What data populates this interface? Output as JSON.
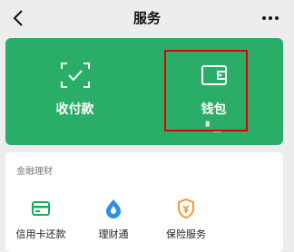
{
  "header": {
    "title": "服务",
    "back_icon": "chevron-left-icon",
    "more_icon": "more-dots-icon"
  },
  "wallet_card": {
    "color": "#2aae67",
    "tiles": [
      {
        "label": "收付款",
        "icon": "scan-pay-icon"
      },
      {
        "label": "钱包",
        "icon": "wallet-icon",
        "balance": "▘▁"
      }
    ],
    "highlight_color": "#e00000"
  },
  "finance": {
    "section_title": "金融理财",
    "items": [
      {
        "label": "信用卡还款",
        "icon": "credit-card-icon",
        "color": "#1aad5a"
      },
      {
        "label": "理财通",
        "icon": "wealth-drop-icon",
        "color": "#2b8fe8"
      },
      {
        "label": "保险服务",
        "icon": "insurance-shield-icon",
        "color": "#f29a2e"
      }
    ]
  }
}
